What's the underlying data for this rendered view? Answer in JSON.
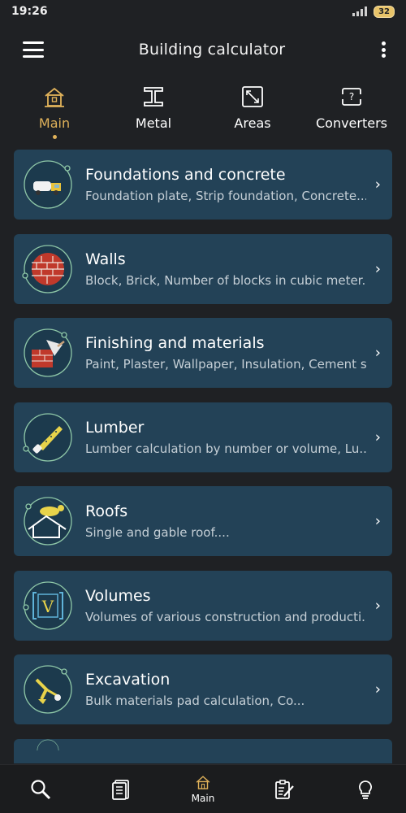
{
  "status": {
    "time": "19:26",
    "battery": "32"
  },
  "app": {
    "title": "Building calculator",
    "menu_icon": "hamburger-menu-icon",
    "more_icon": "more-vertical-icon"
  },
  "tabs": [
    {
      "label": "Main",
      "icon": "house-icon",
      "active": true
    },
    {
      "label": "Metal",
      "icon": "i-beam-icon",
      "active": false
    },
    {
      "label": "Areas",
      "icon": "area-expand-icon",
      "active": false
    },
    {
      "label": "Converters",
      "icon": "converter-icon",
      "active": false
    }
  ],
  "categories": [
    {
      "title": "Foundations and concrete",
      "subtitle": "Foundation plate, Strip foundation, Concrete....",
      "icon": "concrete-mixer-truck-icon"
    },
    {
      "title": "Walls",
      "subtitle": "Block, Brick, Number of blocks in cubic meter....",
      "icon": "brick-wall-icon"
    },
    {
      "title": "Finishing and materials",
      "subtitle": "Paint, Plaster, Wallpaper, Insulation, Cement s...",
      "icon": "trowel-brick-icon"
    },
    {
      "title": "Lumber",
      "subtitle": "Lumber calculation by number or volume, Lu...",
      "icon": "saw-icon"
    },
    {
      "title": "Roofs",
      "subtitle": "Single and gable roof....",
      "icon": "roof-icon"
    },
    {
      "title": "Volumes",
      "subtitle": "Volumes of various construction and producti...",
      "icon": "volume-icon"
    },
    {
      "title": "Excavation",
      "subtitle": "Bulk materials pad calculation, Co...",
      "icon": "excavator-icon"
    }
  ],
  "bottom_nav": [
    {
      "icon": "search-icon",
      "label": ""
    },
    {
      "icon": "document-list-icon",
      "label": ""
    },
    {
      "icon": "home-icon",
      "label": "Main"
    },
    {
      "icon": "clipboard-edit-icon",
      "label": ""
    },
    {
      "icon": "lightbulb-icon",
      "label": ""
    }
  ],
  "colors": {
    "background": "#1f2124",
    "card": "#234257",
    "accent": "#e0b25a",
    "ring": "#8fc8a8"
  }
}
